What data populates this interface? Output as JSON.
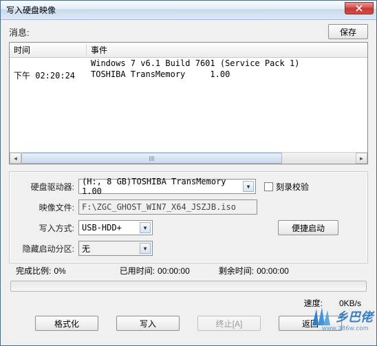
{
  "titlebar": {
    "title": "写入硬盘映像"
  },
  "toprow": {
    "message_label": "消息:",
    "save_label": "保存"
  },
  "log": {
    "col_time": "时间",
    "col_event": "事件",
    "rows": [
      {
        "time": "",
        "event": "Windows 7 v6.1 Build 7601 (Service Pack 1)"
      },
      {
        "time": "下午 02:20:24",
        "event": "TOSHIBA TransMemory     1.00"
      }
    ]
  },
  "form": {
    "drive_label": "硬盘驱动器:",
    "drive_value": "(H:, 8 GB)TOSHIBA TransMemory     1.00",
    "verify_label": "刻录校验",
    "image_label": "映像文件:",
    "image_value": "F:\\ZGC_GHOST_WIN7_X64_JSZJB.iso",
    "write_mode_label": "写入方式:",
    "write_mode_value": "USB-HDD+",
    "quickboot_label": "便捷启动",
    "hide_boot_label": "隐藏启动分区:",
    "hide_boot_value": "无"
  },
  "stats": {
    "done_label": "完成比例:",
    "done_value": "0%",
    "elapsed_label": "已用时间:",
    "elapsed_value": "00:00:00",
    "remain_label": "剩余时间:",
    "remain_value": "00:00:00",
    "speed_label": "速度:",
    "speed_value": "0KB/s"
  },
  "buttons": {
    "format": "格式化",
    "write": "写入",
    "abort": "终止[A]",
    "back": "返回"
  },
  "watermark": {
    "text": "乡巴佬",
    "url": "www.386w.com"
  },
  "icons": {
    "close": "close-icon",
    "caret": "chevron-down-icon",
    "scroll_left": "chevron-left-icon",
    "scroll_right": "chevron-right-icon"
  }
}
